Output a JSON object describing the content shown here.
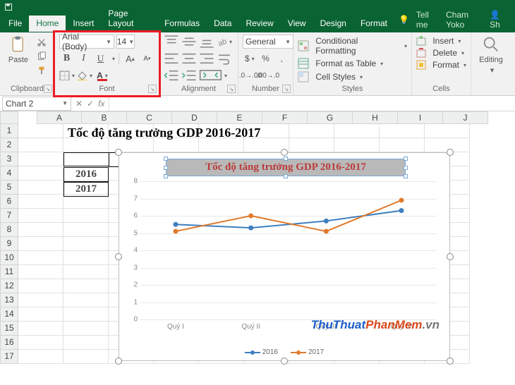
{
  "titlebar": {
    "file": "File",
    "user": "Cham Yoko",
    "share": "Sh"
  },
  "tabs": [
    "Home",
    "Insert",
    "Page Layout",
    "Formulas",
    "Data",
    "Review",
    "View",
    "Design",
    "Format"
  ],
  "tellme": "Tell me",
  "ribbon": {
    "clipboard": {
      "paste": "Paste",
      "label": "Clipboard"
    },
    "font": {
      "name": "Arial (Body)",
      "size": "14",
      "label": "Font",
      "bold": "B",
      "italic": "I",
      "underline": "U"
    },
    "alignment": {
      "label": "Alignment"
    },
    "number": {
      "format": "General",
      "label": "Number"
    },
    "styles": {
      "cond": "Conditional Formatting",
      "table": "Format as Table",
      "cellst": "Cell Styles",
      "label": "Styles"
    },
    "cells": {
      "insert": "Insert",
      "delete": "Delete",
      "format": "Format",
      "label": "Cells"
    },
    "editing": {
      "label": "Editing"
    }
  },
  "namebox": "Chart 2",
  "columns": [
    "A",
    "B",
    "C",
    "D",
    "E",
    "F",
    "G",
    "H",
    "I",
    "J"
  ],
  "rows": [
    "1",
    "2",
    "3",
    "4",
    "5",
    "6",
    "7",
    "8",
    "9",
    "10",
    "11",
    "12",
    "13",
    "14",
    "15",
    "16",
    "17"
  ],
  "sheet": {
    "title": "Tốc độ tăng trưởng GDP 2016-2017",
    "headers": [
      "Quý I",
      "Quý II",
      "Quý III",
      "Quý IV"
    ],
    "yearA": "2016",
    "yearB": "2017"
  },
  "chart_data": {
    "type": "line",
    "title": "Tốc độ tăng trưởng GDP 2016-2017",
    "categories": [
      "Quý I",
      "Quý II",
      "Quý III",
      "Quý IV"
    ],
    "series": [
      {
        "name": "2016",
        "color": "#3f7fbf",
        "values": [
          5.5,
          5.3,
          5.7,
          6.3
        ]
      },
      {
        "name": "2017",
        "color": "#e07b2e",
        "values": [
          5.1,
          6.0,
          5.1,
          6.9
        ]
      }
    ],
    "ylabel": "",
    "xlabel": "",
    "ylim": [
      0,
      8
    ],
    "yticks": [
      0,
      1,
      2,
      3,
      4,
      5,
      6,
      7,
      8
    ]
  },
  "watermark": {
    "a": "ThuThuat",
    "b": "PhanMem",
    "c": ".vn"
  }
}
